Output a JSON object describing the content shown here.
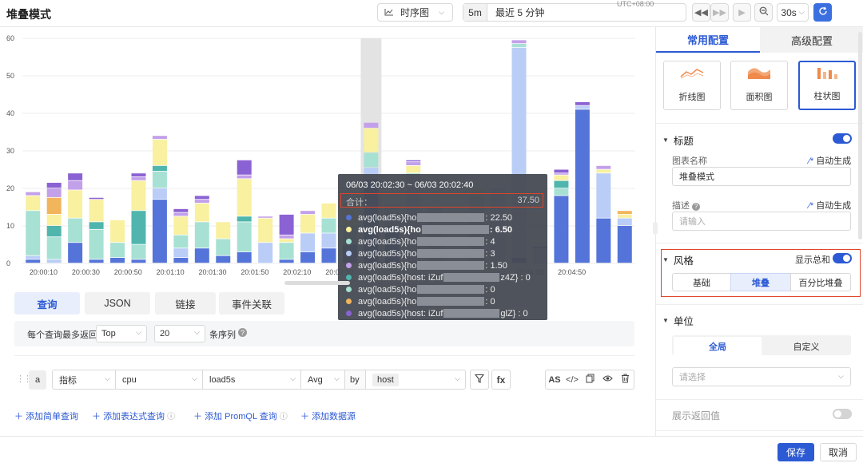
{
  "header": {
    "title": "堆叠模式",
    "chart_type_label": "时序图",
    "time_step": "5m",
    "time_range": "最近 5 分钟",
    "timezone": "UTC+08:00",
    "refresh_interval": "30s"
  },
  "chart_data": {
    "type": "bar",
    "stacked": true,
    "ylim": [
      0,
      60
    ],
    "yticks": [
      "0",
      "10",
      "20",
      "30",
      "40",
      "50",
      "60"
    ],
    "xticks": [
      "20:00:10",
      "20:00:30",
      "20:00:50",
      "20:01:10",
      "20:01:30",
      "20:01:50",
      "20:02:10",
      "20:02:30",
      "20:04:30",
      "20:04:50"
    ],
    "grid": true,
    "series_colors": [
      "#5474d9",
      "#b9cdf7",
      "#a7e1d3",
      "#4fb5ad",
      "#f9f0a0",
      "#f1b55c",
      "#c3a0ea",
      "#8b62d4"
    ],
    "bars": [
      [
        1.0,
        1.0,
        12.0,
        0,
        4.0,
        0,
        1.0,
        0
      ],
      [
        0,
        1.0,
        6.0,
        3.0,
        3.0,
        4.5,
        2.5,
        1.5
      ],
      [
        5.5,
        0,
        6.5,
        0,
        7.5,
        0,
        2.5,
        2.0
      ],
      [
        1.0,
        0,
        8.0,
        2.0,
        6.0,
        0,
        0,
        0.5
      ],
      [
        1.5,
        0,
        4.0,
        0,
        6.0,
        0,
        0,
        0
      ],
      [
        1.0,
        0,
        4.0,
        9.0,
        8.0,
        0,
        1.0,
        1.0
      ],
      [
        17.0,
        3.0,
        4.5,
        1.5,
        7.0,
        0,
        1.0,
        0
      ],
      [
        1.5,
        2.5,
        3.5,
        0,
        5.0,
        0,
        1.0,
        1.0
      ],
      [
        4.0,
        0,
        7.0,
        0,
        5.0,
        0,
        1.0,
        1.0
      ],
      [
        2.0,
        0,
        4.5,
        0,
        4.5,
        0,
        0,
        0
      ],
      [
        3.0,
        0,
        8.0,
        1.5,
        10.0,
        0,
        1.0,
        4.0
      ],
      [
        0,
        5.5,
        0,
        0,
        6.5,
        0,
        0.5,
        0
      ],
      [
        1.0,
        0,
        4.5,
        0,
        1.0,
        0,
        1.0,
        5.5
      ],
      [
        3.0,
        5.0,
        0,
        0,
        5.0,
        0,
        1.0,
        0
      ],
      [
        4.0,
        4.0,
        4.0,
        0,
        4.0,
        0,
        0,
        0
      ],
      [
        5.0,
        0,
        5.0,
        0,
        5.0,
        0,
        1.0,
        0
      ],
      [
        22.5,
        3.0,
        4.0,
        0,
        6.5,
        0,
        1.5,
        0
      ],
      [
        10.0,
        6.0,
        0,
        0,
        0,
        0,
        0,
        0
      ],
      [
        0,
        23.0,
        1.0,
        0,
        2.0,
        0,
        1.0,
        0.5
      ],
      [
        0,
        15.0,
        0,
        0,
        0,
        0,
        0,
        0
      ],
      [
        0,
        0,
        0,
        0,
        0,
        0,
        0,
        0
      ],
      [
        0,
        15.0,
        3.0,
        0,
        2.0,
        0,
        0,
        0
      ],
      [
        0,
        20.0,
        0,
        0,
        0,
        0,
        0,
        0
      ],
      [
        1.5,
        56.0,
        1.0,
        0,
        0,
        0,
        1.0,
        0
      ],
      [
        0,
        4.0,
        0,
        0,
        0,
        0,
        0,
        0.5
      ],
      [
        18.0,
        0,
        2.0,
        2.0,
        1.5,
        0,
        0.5,
        1.0
      ],
      [
        41.0,
        1.0,
        0,
        0,
        0,
        0,
        0,
        1.0
      ],
      [
        12.0,
        12.0,
        0,
        0,
        1.0,
        0,
        1.0,
        0
      ],
      [
        10.0,
        2.0,
        0,
        0,
        1.0,
        1.0,
        0,
        0
      ]
    ],
    "highlighted_index": 16
  },
  "tooltip": {
    "time": "06/03 20:02:30 ~ 06/03 20:02:40",
    "total_label": "合计：",
    "total_value": "37.50",
    "rows": [
      {
        "color": "#5474d9",
        "prefix": "avg(load5s){ho",
        "suffix": ": 22.50",
        "bold": false
      },
      {
        "color": "#f9f0a0",
        "prefix": "avg(load5s){ho",
        "suffix": ": 6.50",
        "bold": true
      },
      {
        "color": "#a7e1d3",
        "prefix": "avg(load5s){ho",
        "suffix": ": 4",
        "bold": false
      },
      {
        "color": "#b9cdf7",
        "prefix": "avg(load5s){ho",
        "suffix": ": 3",
        "bold": false
      },
      {
        "color": "#c3a0ea",
        "prefix": "avg(load5s){ho",
        "suffix": ": 1.50",
        "bold": false
      },
      {
        "color": "#4fb5ad",
        "prefix": "avg(load5s){host: iZuf",
        "suffix": "z4Z} : 0",
        "bold": false
      },
      {
        "color": "#a7e1d3",
        "prefix": "avg(load5s){ho",
        "suffix": ": 0",
        "bold": false
      },
      {
        "color": "#f1b55c",
        "prefix": "avg(load5s){ho",
        "suffix": ": 0",
        "bold": false
      },
      {
        "color": "#8b62d4",
        "prefix": "avg(load5s){host: iZuf",
        "suffix": "glZ} : 0",
        "bold": false
      }
    ]
  },
  "query": {
    "tabs": [
      "查询",
      "JSON",
      "链接",
      "事件关联"
    ],
    "limit_prefix": "每个查询最多返回",
    "limit_mode": "Top",
    "limit_count": "20",
    "limit_suffix": "条序列",
    "row": {
      "letter": "a",
      "source_type": "指标",
      "metric_group": "cpu",
      "metric": "load5s",
      "aggregation": "Avg",
      "by_label": "by",
      "by_value": "host"
    },
    "fx_label": "fx",
    "as_label": "AS",
    "add_links": [
      "添加简单查询",
      "添加表达式查询",
      "添加 PromQL 查询",
      "添加数据源"
    ]
  },
  "panel": {
    "tabs": [
      "常用配置",
      "高级配置"
    ],
    "chart_types": [
      "折线图",
      "面积图",
      "柱状图"
    ],
    "title_section": "标题",
    "chart_name_label": "图表名称",
    "auto_generate": "自动生成",
    "chart_name_value": "堆叠模式",
    "desc_label": "描述",
    "desc_placeholder": "请输入",
    "style_section": "风格",
    "show_total_label": "显示总和",
    "style_options": [
      "基础",
      "堆叠",
      "百分比堆叠"
    ],
    "unit_section": "单位",
    "unit_options": [
      "全局",
      "自定义"
    ],
    "unit_placeholder": "请选择",
    "show_values_label": "展示返回值"
  },
  "footer": {
    "save": "保存",
    "cancel": "取消"
  }
}
